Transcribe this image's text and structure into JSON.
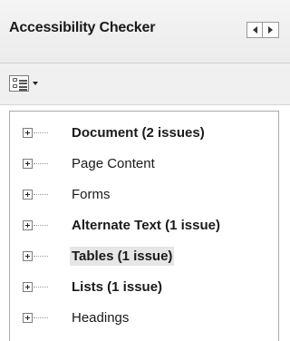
{
  "panel": {
    "title": "Accessibility Checker",
    "nav": {
      "prev_icon": "triangle-left-icon",
      "next_icon": "triangle-right-icon"
    }
  },
  "toolbar": {
    "options_icon": "options-list-icon",
    "dropdown_icon": "caret-down-icon"
  },
  "tree": {
    "items": [
      {
        "label": "Document (2 issues)",
        "bold": true,
        "selected": false
      },
      {
        "label": "Page Content",
        "bold": false,
        "selected": false
      },
      {
        "label": "Forms",
        "bold": false,
        "selected": false
      },
      {
        "label": "Alternate Text (1 issue)",
        "bold": true,
        "selected": false
      },
      {
        "label": "Tables (1 issue)",
        "bold": true,
        "selected": true
      },
      {
        "label": "Lists (1 issue)",
        "bold": true,
        "selected": false
      },
      {
        "label": "Headings",
        "bold": false,
        "selected": false
      }
    ]
  }
}
